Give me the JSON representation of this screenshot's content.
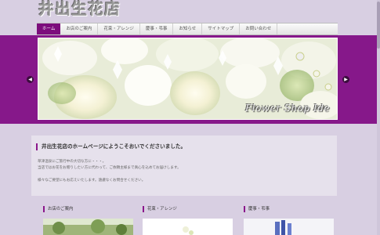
{
  "header": {
    "logo_text": "井出生花店"
  },
  "nav": {
    "items": [
      {
        "label": "ホーム",
        "active": true
      },
      {
        "label": "お店のご案内"
      },
      {
        "label": "花束・アレンジ"
      },
      {
        "label": "慶事・弔事"
      },
      {
        "label": "お知らせ"
      },
      {
        "label": "サイトマップ"
      },
      {
        "label": "お問い合わせ"
      }
    ]
  },
  "hero": {
    "caption": "Flower Shop Ide"
  },
  "welcome": {
    "title": "井出生花店のホームページにようこそおいでくださいました。",
    "lines": [
      "草津温泉にご旅行中の大切な方に・・・。",
      "当店ではお花をお贈りしたい方に代わって、ご依頼主様まで真心を込めてお届けします。",
      "様々なご要望にもお応えいたします。遠慮なくお問合せください。"
    ]
  },
  "sections": [
    {
      "title": "お店のご案内"
    },
    {
      "title": "花束・アレンジ"
    },
    {
      "title": "慶事・弔事"
    }
  ],
  "colors": {
    "accent": "#86188a",
    "nav_active": "#7c0d7c",
    "background": "#d8cfe2"
  }
}
